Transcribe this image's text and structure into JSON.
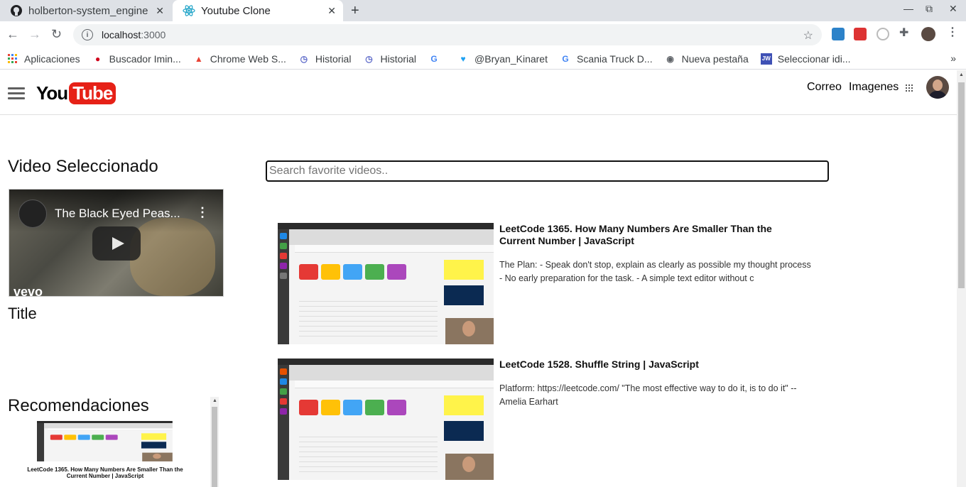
{
  "browser": {
    "tabs": [
      {
        "title": "holberton-system_engine",
        "icon": "github-icon"
      },
      {
        "title": "Youtube Clone",
        "icon": "react-icon"
      }
    ],
    "address": {
      "host": "localhost",
      "port": ":3000"
    },
    "bookmarks": [
      {
        "label": "Aplicaciones",
        "icon": "apps-grid-icon"
      },
      {
        "label": "Buscador Imin...",
        "icon": "chat-icon"
      },
      {
        "label": "Chrome Web S...",
        "icon": "chrome-store-icon"
      },
      {
        "label": "Historial",
        "icon": "history-icon"
      },
      {
        "label": "Historial",
        "icon": "history-icon"
      },
      {
        "label": "",
        "icon": "google-icon"
      },
      {
        "label": "@Bryan_Kinaret",
        "icon": "twitter-icon"
      },
      {
        "label": "Scania Truck D...",
        "icon": "google-icon"
      },
      {
        "label": "Nueva pestaña",
        "icon": "globe-icon"
      },
      {
        "label": "Seleccionar idi...",
        "icon": "jw-icon"
      }
    ],
    "more": "»"
  },
  "header": {
    "logo_you": "You",
    "logo_tube": "Tube",
    "links": [
      "Correo",
      "Imagenes"
    ]
  },
  "selected": {
    "heading": "Video Seleccionado",
    "video_title": "The Black Eyed Peas...",
    "watermark": "vevo",
    "title_label": "Title"
  },
  "recommendations": {
    "heading": "Recomendaciones",
    "items": [
      {
        "caption": "LeetCode 1365. How Many Numbers Are Smaller Than the Current Number | JavaScript"
      }
    ]
  },
  "search": {
    "placeholder": "Search favorite videos.."
  },
  "videos": [
    {
      "title": "LeetCode 1365. How Many Numbers Are Smaller Than the Current Number | JavaScript",
      "description": "The Plan: - Speak don't stop, explain as clearly as possible my thought process - No early preparation for the task. - A simple text editor without c"
    },
    {
      "title": "LeetCode 1528. Shuffle String | JavaScript",
      "description": "Platform: https://leetcode.com/ \"The most effective way to do it, is to do it\" -- Amelia Earhart"
    }
  ],
  "colors": {
    "youtube_red": "#e62117",
    "tab_strip": "#dee1e6",
    "omnibox": "#f1f3f4"
  }
}
